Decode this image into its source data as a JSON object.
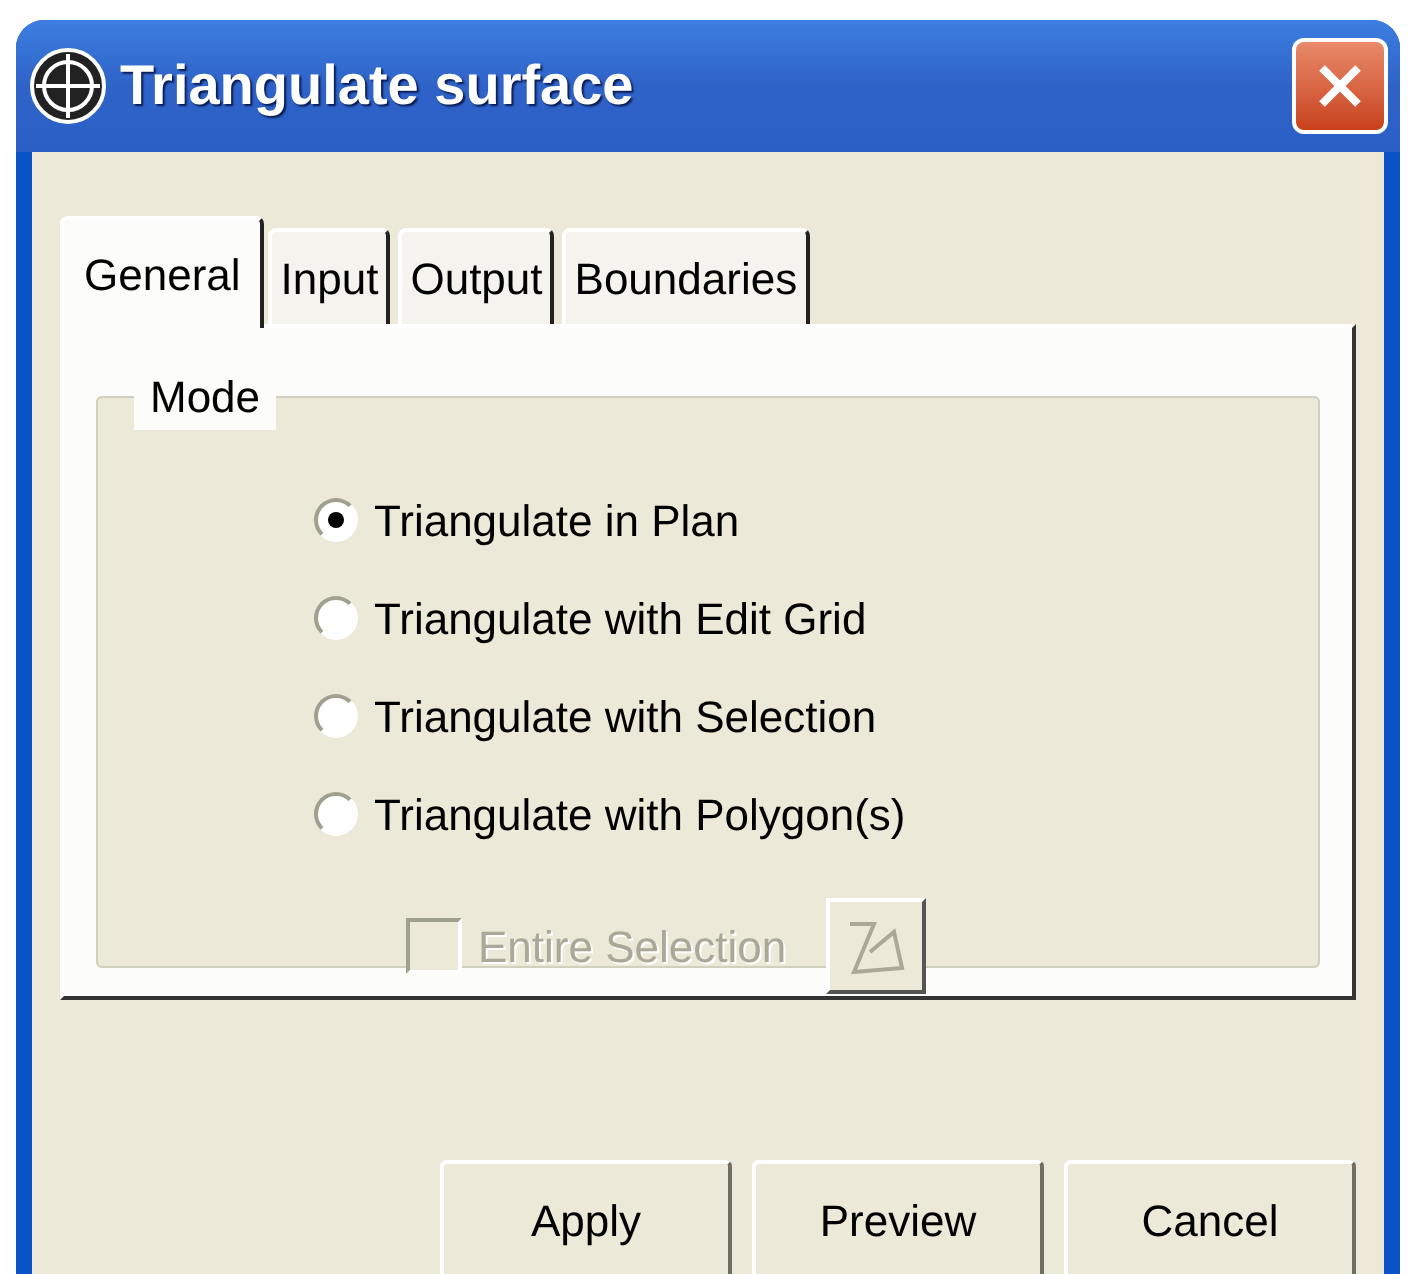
{
  "window": {
    "title": "Triangulate surface"
  },
  "tabs": [
    {
      "label": "General",
      "selected": true
    },
    {
      "label": "Input",
      "selected": false
    },
    {
      "label": "Output",
      "selected": false
    },
    {
      "label": "Boundaries",
      "selected": false
    }
  ],
  "mode": {
    "legend": "Mode",
    "options": [
      {
        "label": "Triangulate in Plan",
        "selected": true
      },
      {
        "label": "Triangulate with Edit Grid",
        "selected": false
      },
      {
        "label": "Triangulate with Selection",
        "selected": false
      },
      {
        "label": "Triangulate with Polygon(s)",
        "selected": false
      }
    ],
    "entire_selection": {
      "label": "Entire Selection",
      "checked": false,
      "disabled": true
    }
  },
  "buttons": [
    "Apply",
    "Preview",
    "Cancel"
  ]
}
